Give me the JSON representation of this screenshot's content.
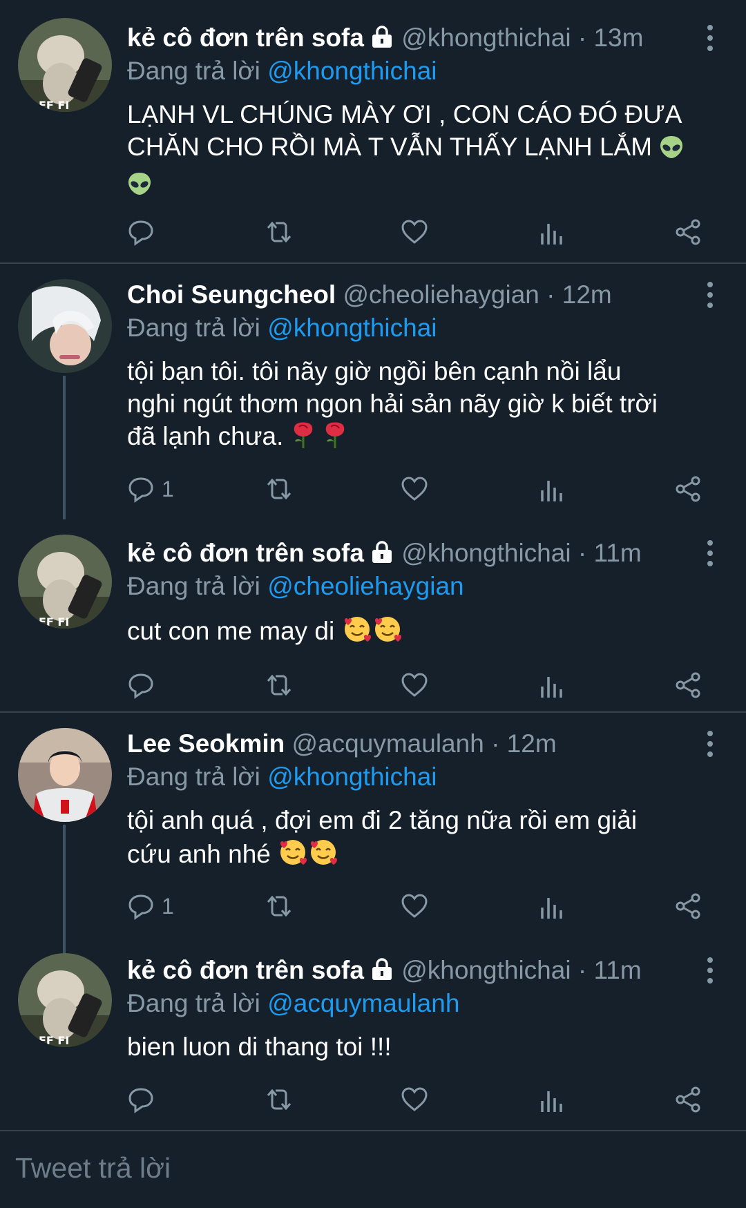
{
  "tweets": [
    {
      "name": "kẻ cô đơn trên sofa",
      "handle": "@khongthichai",
      "time": "13m",
      "sep": "·",
      "replying_prefix": "Đang trả lời",
      "replying_to": "@khongthichai",
      "text_lines": [
        "LẠNH VL CHÚNG MÀY ƠI , CON CÁO ĐÓ ĐƯA",
        "CHĂN CHO RỒI MÀ T VẪN THẤY LẠNH LẮM",
        ""
      ],
      "emoji": "alien",
      "reply_count": "",
      "protected": true
    },
    {
      "name": "Choi Seungcheol",
      "handle": "@cheoliehaygian",
      "time": "12m",
      "sep": "·",
      "replying_prefix": "Đang trả lời",
      "replying_to": "@khongthichai",
      "text_lines": [
        "tội bạn tôi.  tôi nãy giờ ngồi bên cạnh nồi lẩu",
        "nghi ngút thơm ngon hải sản nãy giờ k biết trời",
        "đã lạnh chưa."
      ],
      "emoji": "rose",
      "reply_count": "1",
      "protected": false
    },
    {
      "name": "kẻ cô đơn trên sofa",
      "handle": "@khongthichai",
      "time": "11m",
      "sep": "·",
      "replying_prefix": "Đang trả lời",
      "replying_to": "@cheoliehaygian",
      "text_lines": [
        "cut con me may di"
      ],
      "emoji": "smiling-hearts",
      "reply_count": "",
      "protected": true
    },
    {
      "name": "Lee Seokmin",
      "handle": "@acquymaulanh",
      "time": "12m",
      "sep": "·",
      "replying_prefix": "Đang trả lời",
      "replying_to": "@khongthichai",
      "text_lines": [
        "tội anh quá , đợi em đi 2 tăng nữa rồi em giải",
        "cứu anh nhé"
      ],
      "emoji": "smiling-hearts",
      "reply_count": "1",
      "protected": false
    },
    {
      "name": "kẻ cô đơn trên sofa",
      "handle": "@khongthichai",
      "time": "11m",
      "sep": "·",
      "replying_prefix": "Đang trả lời",
      "replying_to": "@acquymaulanh",
      "text_lines": [
        "bien luon di thang toi !!!"
      ],
      "emoji": "",
      "reply_count": "",
      "protected": true
    }
  ],
  "composer": {
    "placeholder": "Tweet trả lời"
  },
  "icons": {
    "reply": "reply-icon",
    "retweet": "retweet-icon",
    "like": "heart-icon",
    "analytics": "analytics-icon",
    "share": "share-icon",
    "more": "more-vertical-icon",
    "lock": "lock-icon"
  },
  "colors": {
    "background": "#15202b",
    "mention": "#1d9bf0",
    "secondary": "#8899a6",
    "divider": "#38444d"
  }
}
